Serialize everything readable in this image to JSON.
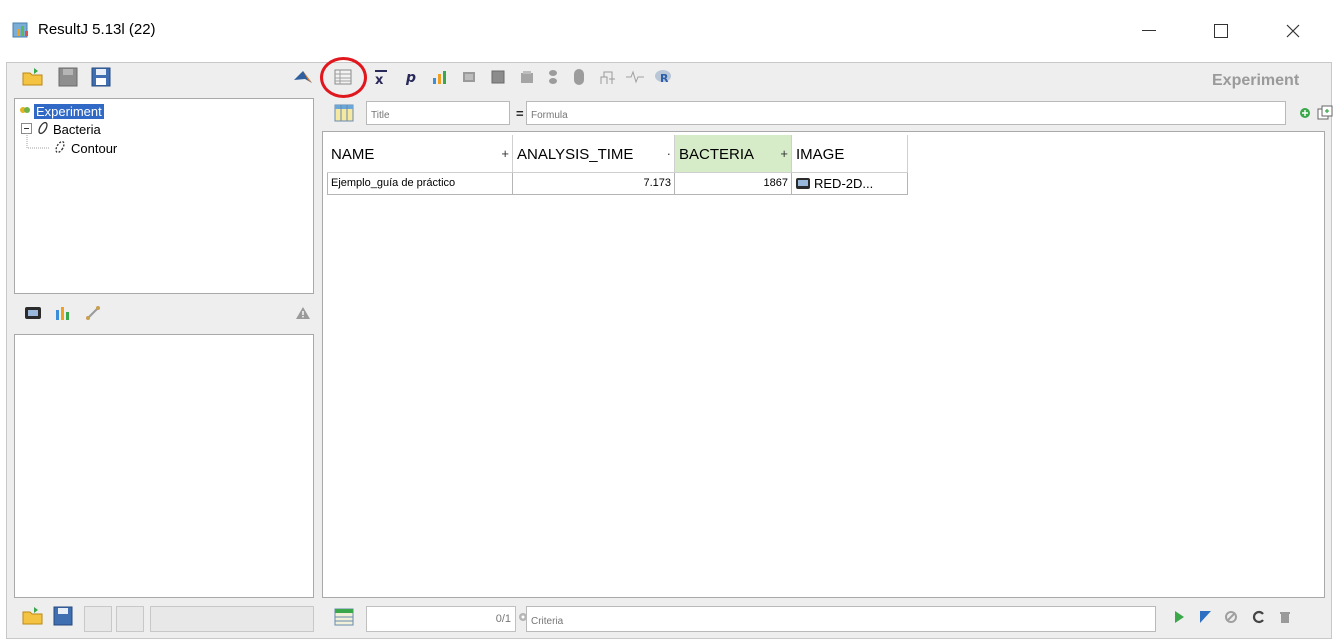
{
  "window": {
    "title": "ResultJ 5.13l (22)"
  },
  "toolbar": {
    "right_label": "Experiment"
  },
  "tree": {
    "items": [
      {
        "label": "Experiment",
        "selected": true
      },
      {
        "label": "Bacteria"
      },
      {
        "label": "Contour"
      }
    ]
  },
  "filter": {
    "title_placeholder": "Title",
    "equals": "=",
    "formula_placeholder": "Formula"
  },
  "table": {
    "columns": [
      {
        "label": "NAME",
        "plus": "+"
      },
      {
        "label": "ANALYSIS_TIME",
        "plus": "·"
      },
      {
        "label": "BACTERIA",
        "plus": "+"
      },
      {
        "label": "IMAGE",
        "plus": ""
      }
    ],
    "rows": [
      {
        "name": "Ejemplo_guía de práctico",
        "analysis_time": "7.173",
        "bacteria": "1867",
        "image": "RED-2D..."
      }
    ]
  },
  "footer": {
    "counter": "0/1",
    "criteria_placeholder": "Criteria"
  },
  "colors": {
    "selection": "#3169c6",
    "highlight_column": "#d6ecc8",
    "annotation_circle": "#e0181e"
  }
}
